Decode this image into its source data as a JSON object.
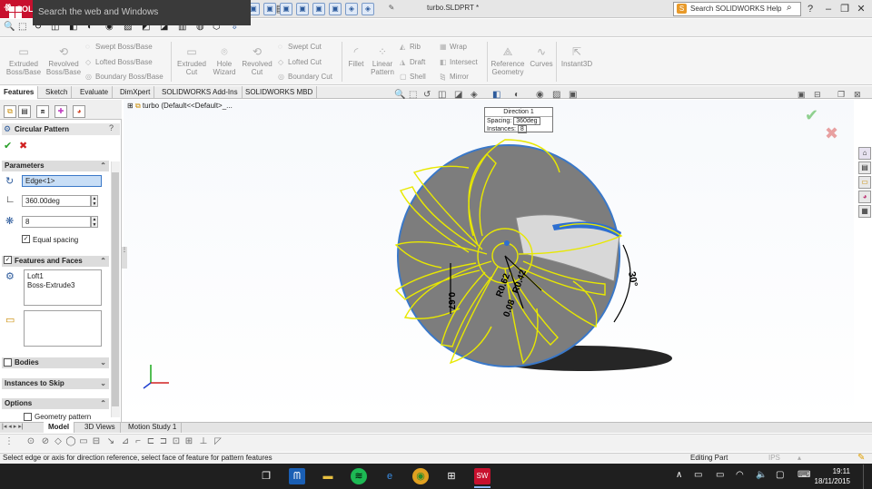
{
  "app": {
    "brand": "SOLIDWORKS",
    "doc_title": "turbo.SLDPRT *",
    "search_placeholder": "Search SOLIDWORKS Help"
  },
  "ribbon": {
    "extruded_boss": [
      "Extruded",
      "Boss/Base"
    ],
    "revolved_boss": [
      "Revolved",
      "Boss/Base"
    ],
    "swept_boss": "Swept Boss/Base",
    "lofted_boss": "Lofted Boss/Base",
    "boundary_boss": "Boundary Boss/Base",
    "extruded_cut": [
      "Extruded",
      "Cut"
    ],
    "hole_wizard": [
      "Hole",
      "Wizard"
    ],
    "revolved_cut": [
      "Revolved",
      "Cut"
    ],
    "swept_cut": "Swept Cut",
    "lofted_cut": "Lofted Cut",
    "boundary_cut": "Boundary Cut",
    "fillet": "Fillet",
    "linear_pattern": [
      "Linear",
      "Pattern"
    ],
    "rib": "Rib",
    "draft": "Draft",
    "shell": "Shell",
    "wrap": "Wrap",
    "intersect": "Intersect",
    "mirror": "Mirror",
    "reference_geometry": [
      "Reference",
      "Geometry"
    ],
    "curves": "Curves",
    "instant3d": "Instant3D"
  },
  "tabs": [
    "Features",
    "Sketch",
    "Evaluate",
    "DimXpert",
    "SOLIDWORKS Add-Ins",
    "SOLIDWORKS MBD"
  ],
  "panel": {
    "title": "Circular Pattern",
    "parameters_label": "Parameters",
    "axis_value": "Edge<1>",
    "angle_value": "360.00deg",
    "instances_value": "8",
    "equal_spacing": "Equal spacing",
    "features_faces_label": "Features and Faces",
    "features": [
      "Loft1",
      "Boss-Extrude3"
    ],
    "bodies_label": "Bodies",
    "instances_skip_label": "Instances to Skip",
    "options_label": "Options",
    "geometry_pattern": "Geometry pattern"
  },
  "viewport": {
    "tree_root": "turbo  (Default<<Default>_...",
    "direction_title": "Direction 1",
    "spacing_label": "Spacing:",
    "spacing_value": "360deg",
    "instances_label": "Instances:",
    "instances_value": "8",
    "dim_angle": "30°",
    "dim_a": "0.67",
    "dim_b": "R0.62",
    "dim_c": "R0.42",
    "dim_d": "0.08"
  },
  "bottom_tabs": [
    "Model",
    "3D Views",
    "Motion Study 1"
  ],
  "status": {
    "message": "Select edge or axis for direction reference, select face of feature for pattern features",
    "mode": "Editing Part",
    "units": "IPS"
  },
  "taskbar": {
    "search_text": "Search the web and Windows",
    "time": "19:11",
    "date": "18/11/2015"
  },
  "colors": {
    "brand_red": "#c8102e",
    "wire_yellow": "#e8e800",
    "body_gray": "#7d7d7d",
    "rim_blue": "#3a78c8"
  }
}
